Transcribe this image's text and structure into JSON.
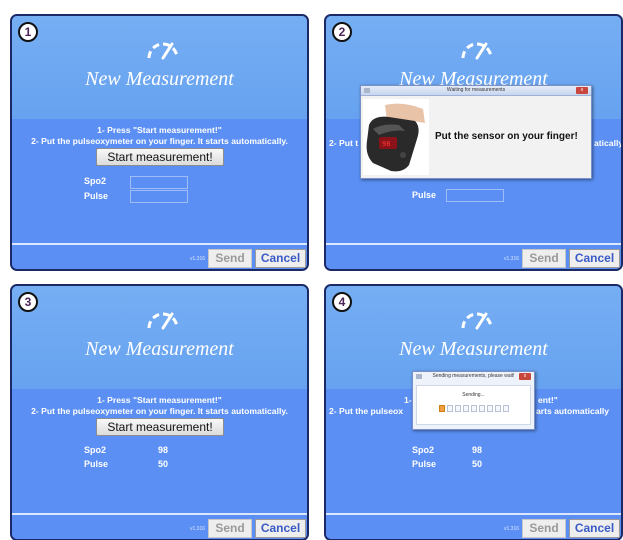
{
  "app": {
    "title": "New Measurement",
    "logo_icon": "gauge-icon",
    "instruction_line1": "1- Press \"Start measurement!\"",
    "instruction_line2": "2- Put the pulseoxymeter on your finger. It starts automatically.",
    "instruction_line2_dialog2_left": "2- Put t",
    "instruction_line2_dialog2_right": "atically",
    "instruction_line1_dialog4_left": "1-",
    "instruction_line1_dialog4_right": "ent!\"",
    "instruction_line2_dialog4_left": "2- Put the pulseox",
    "instruction_line2_dialog4_right": "arts automatically",
    "start_button": "Start measurement!",
    "spo2_label": "Spo2",
    "pulse_label": "Pulse",
    "version": "v1.316",
    "send_button": "Send",
    "cancel_button": "Cancel"
  },
  "steps": [
    {
      "badge": "1",
      "spo2": "",
      "pulse": ""
    },
    {
      "badge": "2",
      "spo2": "",
      "pulse": ""
    },
    {
      "badge": "3",
      "spo2": "98",
      "pulse": "50"
    },
    {
      "badge": "4",
      "spo2": "98",
      "pulse": "50"
    }
  ],
  "dialog_waiting": {
    "title": "Waiting for measurements",
    "message": "Put the sensor on your finger!",
    "close_label": "x"
  },
  "dialog_sending": {
    "title": "Sending measurements, please wait!",
    "message": "Sending...",
    "close_label": "x",
    "progress_segments": 9,
    "progress_active": 1
  },
  "colors": {
    "panel_blue": "#5b8ff4",
    "header_blue": "#76aef3",
    "border_navy": "#1b2a66",
    "cancel_text": "#3a5bc7"
  }
}
